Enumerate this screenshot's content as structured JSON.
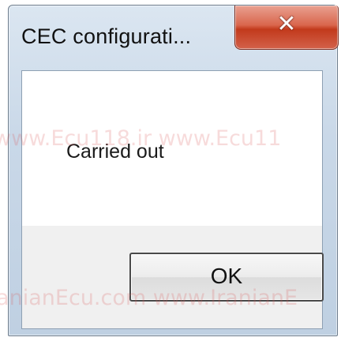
{
  "dialog": {
    "title": "CEC configurati...",
    "close_icon": "close-icon",
    "message": "Carried out",
    "ok_label": "OK"
  },
  "watermark": {
    "line1": "www.Ecu118.ir   www.Ecu11",
    "line2": "ranianEcu.com   www.IranianE"
  },
  "colors": {
    "close_button": "#d2533a",
    "titlebar": "#c9d8e8",
    "watermark": "#dc5a5a"
  }
}
